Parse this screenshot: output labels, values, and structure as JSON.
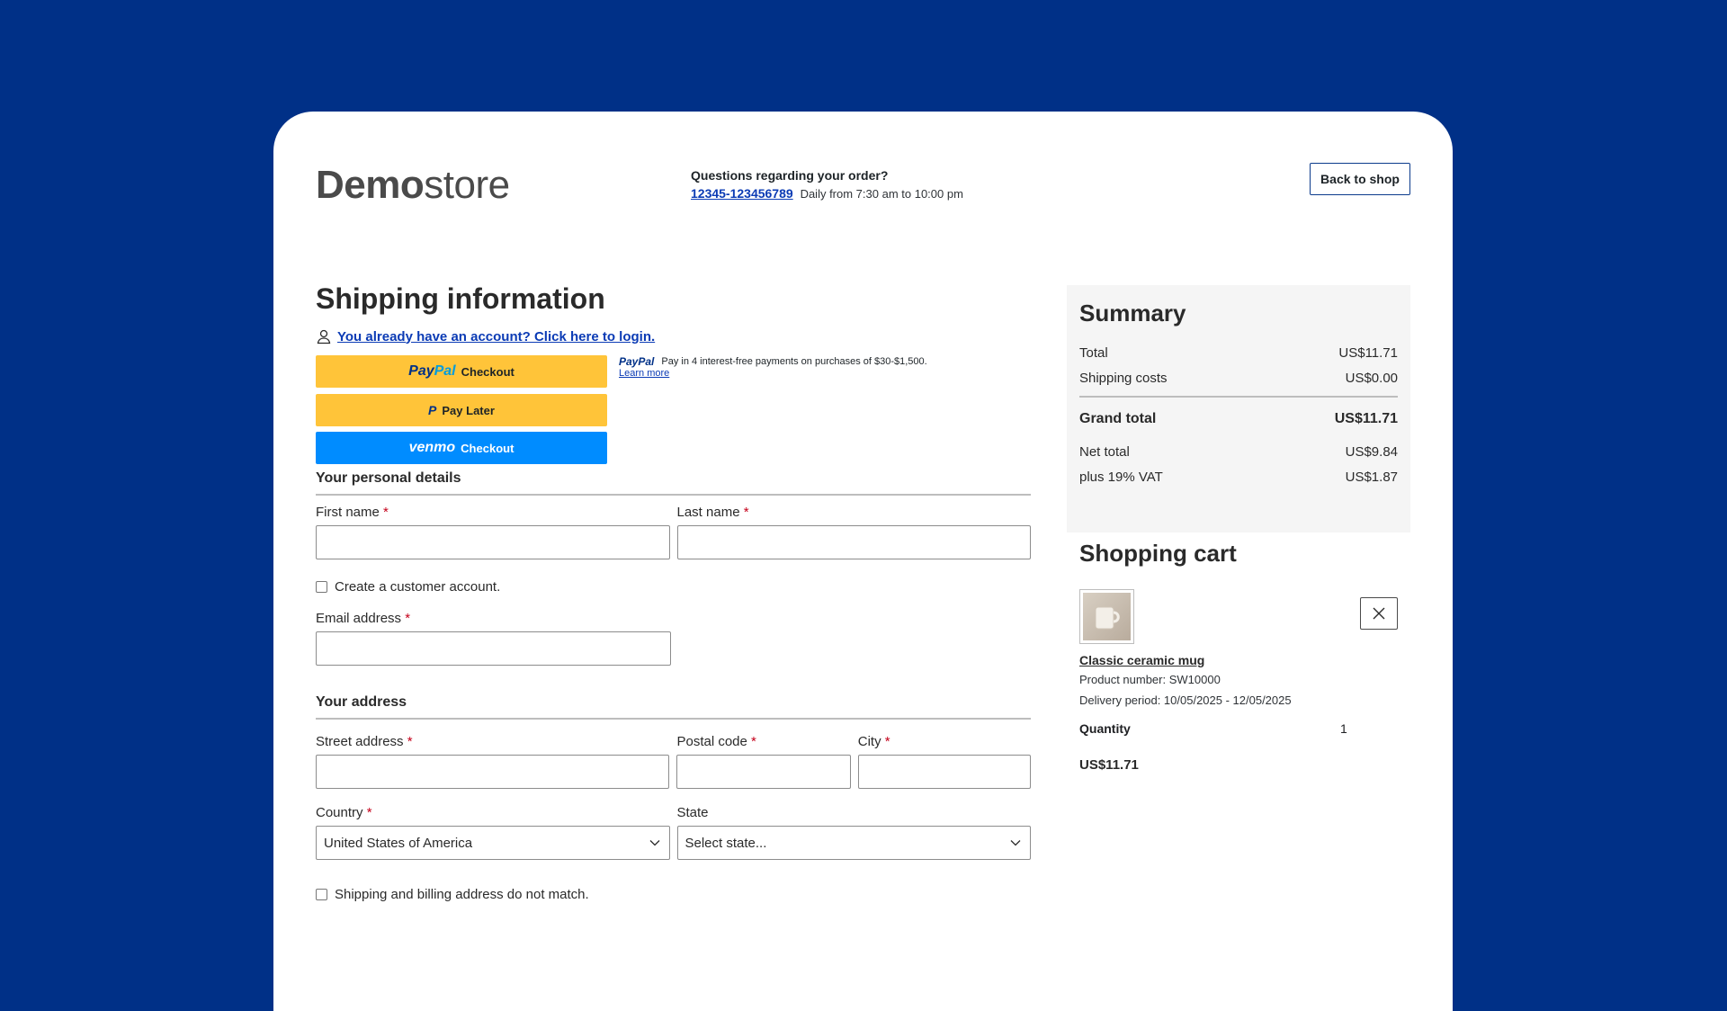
{
  "header": {
    "logo_bold": "Demo",
    "logo_light": "store",
    "help_question": "Questions regarding your order?",
    "phone": "12345-123456789",
    "hours": "Daily from 7:30 am to 10:00 pm",
    "back_button": "Back to shop"
  },
  "main": {
    "title": "Shipping information",
    "login_link": "You already have an account? Click here to login.",
    "paypal": {
      "checkout_logo_part1": "Pay",
      "checkout_logo_part2": "Pal",
      "checkout_label": "Checkout",
      "paylater_mark": "P",
      "paylater_label": "Pay Later",
      "venmo_logo": "venmo",
      "venmo_label": "Checkout",
      "msg_logo": "PayPal",
      "msg_text": "Pay in 4 interest-free payments on purchases of $30-$1,500.",
      "learn_more": "Learn more"
    },
    "personal": {
      "heading": "Your personal details",
      "first_name_label": "First name",
      "last_name_label": "Last name",
      "create_account_label": "Create a customer account.",
      "email_label": "Email address",
      "required_mark": "*"
    },
    "address": {
      "heading": "Your address",
      "street_label": "Street address",
      "postal_label": "Postal code",
      "city_label": "City",
      "country_label": "Country",
      "country_value": "United States of America",
      "state_label": "State",
      "state_value": "Select state...",
      "mismatch_label": "Shipping and billing address do not match."
    }
  },
  "summary": {
    "title": "Summary",
    "total_label": "Total",
    "total_value": "US$11.71",
    "shipping_label": "Shipping costs",
    "shipping_value": "US$0.00",
    "grand_label": "Grand total",
    "grand_value": "US$11.71",
    "net_label": "Net total",
    "net_value": "US$9.84",
    "vat_label": "plus 19% VAT",
    "vat_value": "US$1.87"
  },
  "cart": {
    "title": "Shopping cart",
    "product_name": "Classic ceramic mug",
    "product_number": "Product number: SW10000",
    "delivery": "Delivery period: 10/05/2025 - 12/05/2025",
    "quantity_label": "Quantity",
    "quantity_value": "1",
    "price": "US$11.71"
  }
}
